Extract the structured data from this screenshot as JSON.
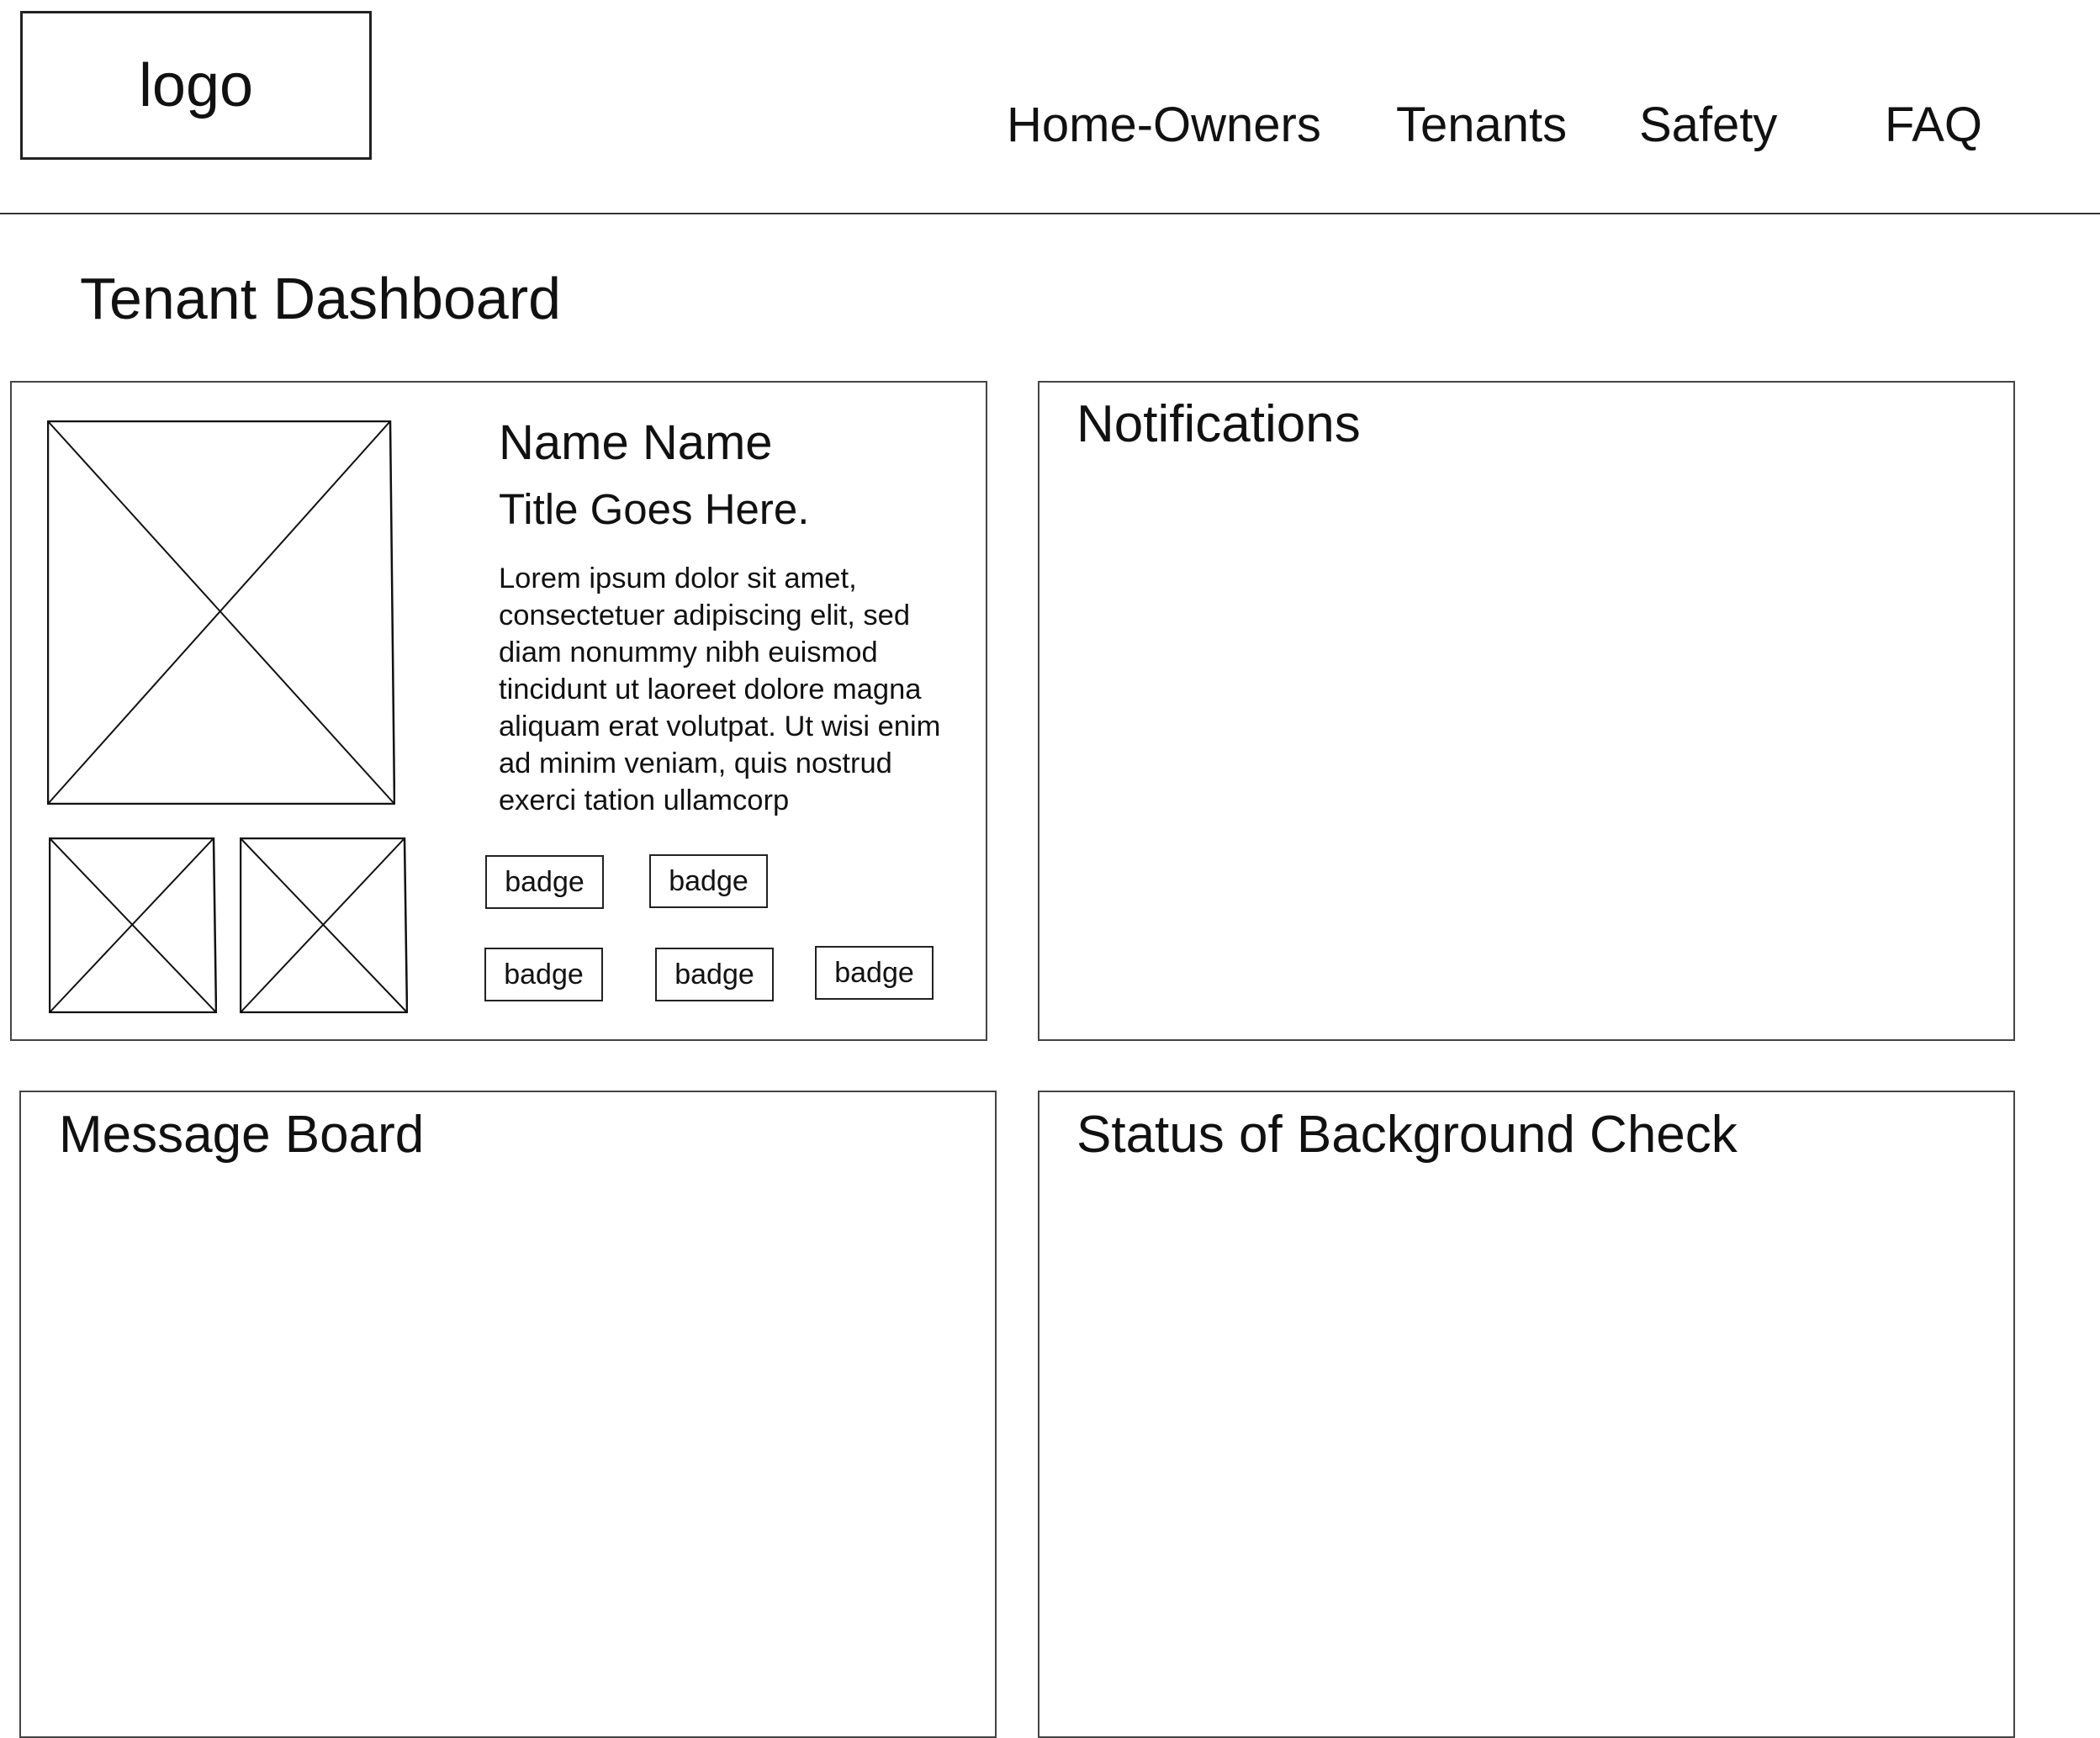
{
  "header": {
    "logo": "logo",
    "nav": [
      "Home-Owners",
      "Tenants",
      "Safety",
      "FAQ"
    ]
  },
  "page": {
    "title": "Tenant Dashboard"
  },
  "profile": {
    "name": "Name Name",
    "title": "Title Goes Here.",
    "description": "Lorem ipsum dolor sit amet, consectetuer adipiscing elit, sed diam nonummy nibh euismod tincidunt ut laoreet dolore magna aliquam erat volutpat. Ut wisi enim ad minim veniam, quis nostrud exerci tation ullamcorp",
    "badges": [
      "badge",
      "badge",
      "badge",
      "badge",
      "badge"
    ]
  },
  "panels": {
    "notifications": "Notifications",
    "message_board": "Message Board",
    "background_check": "Status of Background Check"
  }
}
